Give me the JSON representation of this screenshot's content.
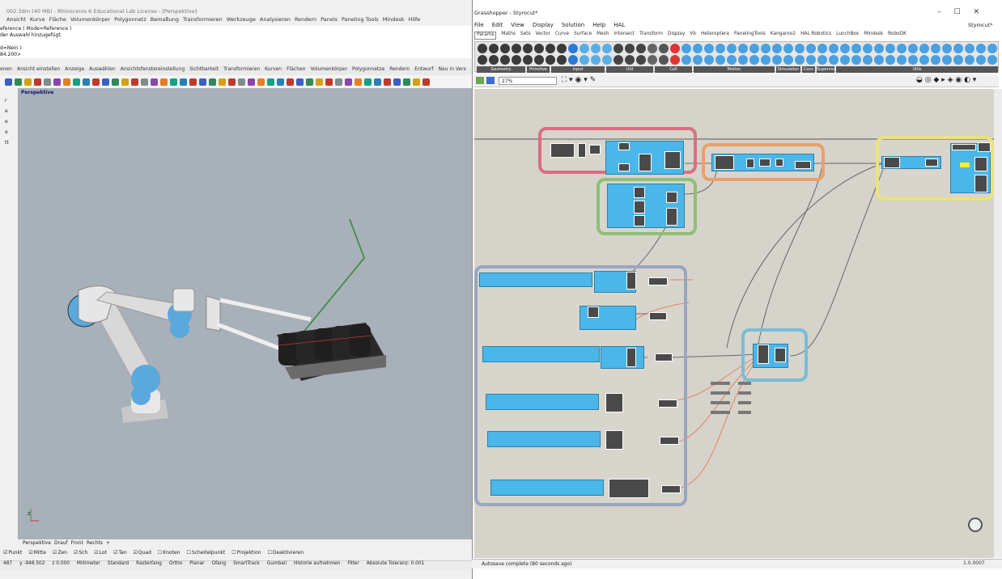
{
  "rhino": {
    "title": "002.3dm (40 MB) - Rhinoceros 6 Educational Lab License - [Perspektive]",
    "menu": [
      "Ansicht",
      "Kurve",
      "Fläche",
      "Volumenkörper",
      "Polygonnetz",
      "Bemaßung",
      "Transformieren",
      "Werkzeuge",
      "Analysieren",
      "Rendern",
      "Panels",
      "Paneling Tools",
      "Mindesk",
      "Hilfe"
    ],
    "command_lines": [
      "eference ( Mode=Reference )",
      "der Auswahl hinzugefügt.",
      "",
      "d=Nein )",
      "84.200>"
    ],
    "toolbar_tabs": [
      "enen",
      "Ansicht einstellen",
      "Anzeige",
      "Auswählen",
      "Ansichtsfenstereinstellung",
      "Sichtbarkeit",
      "Transformieren",
      "Kurven",
      "Flächen",
      "Volumenkörper",
      "Polygonnetze",
      "Rendern",
      "Entwurf",
      "Neu in Vers"
    ],
    "left_letters": [
      "r",
      "e",
      "e",
      "e",
      "tt"
    ],
    "viewport_label": "Perspektive",
    "viewport_tabs": [
      "Perspektive",
      "Drauf",
      "Front",
      "Rechts",
      "+"
    ],
    "osnaps": [
      "Punkt",
      "Mitte",
      "Zen",
      "Sch",
      "Lot",
      "Tan",
      "Quad",
      "Knoten",
      "Scheitelpunkt",
      "Projektion",
      "Deaktivieren"
    ],
    "osnap_checked": [
      true,
      true,
      true,
      true,
      true,
      true,
      true,
      false,
      false,
      false,
      false
    ],
    "status": [
      "487",
      "y -948.502",
      "z 0.000",
      "Millimeter",
      "Standard",
      "Rasterfang",
      "Ortho",
      "Planar",
      "Ofang",
      "SmartTrack",
      "Gumball",
      "Historie aufnehmen",
      "Filter",
      "Absolute Toleranz: 0.001"
    ],
    "accent": "#a8b0b9"
  },
  "gh": {
    "title": "Grasshopper - Styrocut*",
    "menu": [
      "File",
      "Edit",
      "View",
      "Display",
      "Solution",
      "Help",
      "HAL"
    ],
    "doc_name": "Styrocut*",
    "tabs": [
      "Params",
      "Maths",
      "Sets",
      "Vector",
      "Curve",
      "Surface",
      "Mesh",
      "Intersect",
      "Transform",
      "Display",
      "Vb",
      "Heteroptera",
      "PanelingTools",
      "Kangaroo2",
      "HAL Robotics",
      "LunchBox",
      "Mindesk",
      "RoboDK"
    ],
    "groups": [
      "Geometry",
      "Primitive",
      "Input",
      "Util",
      "Cell",
      "Motion",
      "Simulation",
      "Conc",
      "Supervision",
      "Utils"
    ],
    "zoom": "27%",
    "status": "Autosave complete (80 seconds ago)",
    "version": "1.0.0007",
    "group_colors": {
      "red": "#d97082",
      "orange": "#e8a16c",
      "green": "#8fbf77",
      "yellow": "#ece27a",
      "blue": "#9aa5c0",
      "cyan": "#7bbcd6"
    },
    "component_color": "#4ab7e8",
    "canvas_color": "#d6d3cb"
  }
}
